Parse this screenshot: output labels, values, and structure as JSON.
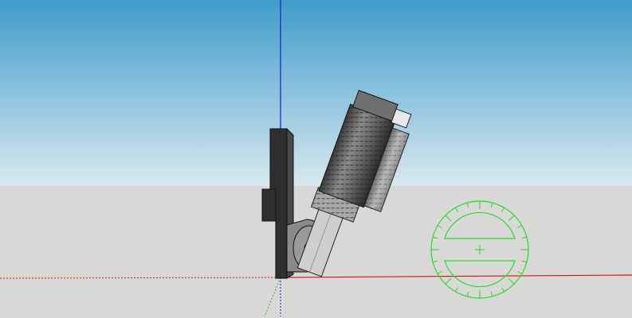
{
  "colors": {
    "sky_top": "#3f9ccb",
    "sky_bottom": "#d9e8ef",
    "ground": "#d8d8d6",
    "axis_red": "#e01010",
    "axis_green": "#2fb82f",
    "axis_blue": "#1a1ad8",
    "protractor": "#22dd22",
    "model_dark": "#2e2e2e",
    "model_mid": "#7b7b7b",
    "model_light": "#c8c8c8"
  },
  "icons": {
    "protractor": "protractor-tool-icon"
  }
}
